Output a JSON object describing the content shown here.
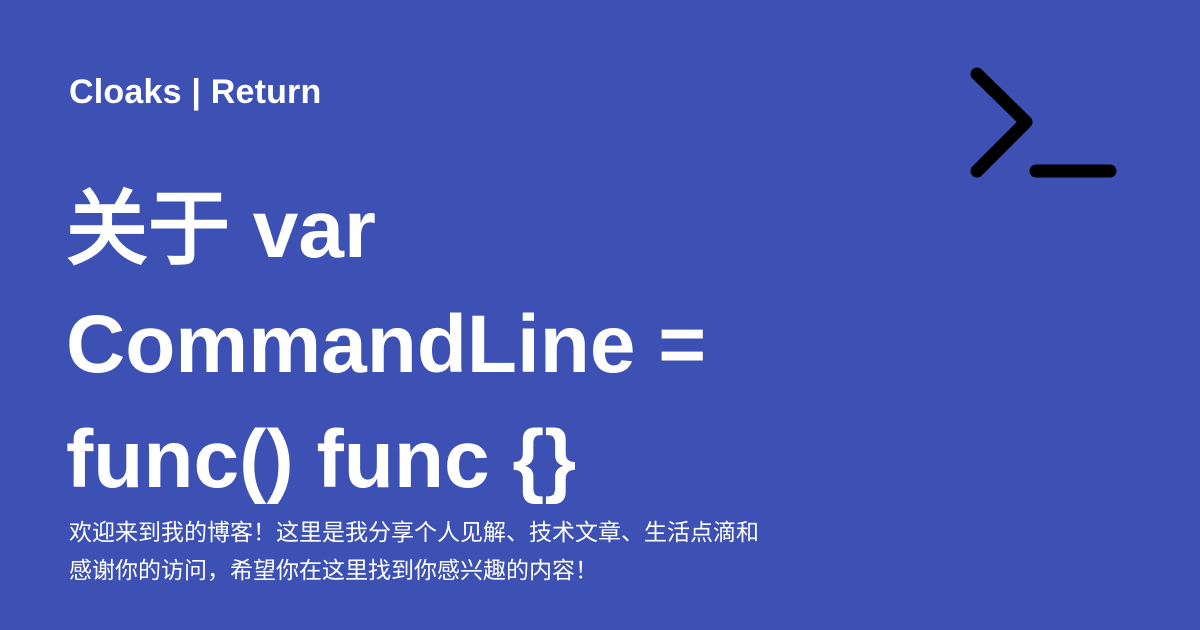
{
  "header": {
    "site_title": "Cloaks | Return"
  },
  "icon": {
    "name": "terminal-prompt-icon",
    "color": "#000000"
  },
  "post": {
    "title_lines": [
      "关于 var",
      "CommandLine =",
      "func() func {}"
    ],
    "description_lines": [
      "欢迎来到我的博客！这里是我分享个人见解、技术文章、生活点滴和",
      "感谢你的访问，希望你在这里找到你感兴趣的内容！"
    ]
  },
  "colors": {
    "background": "#3d51b4",
    "text": "#ffffff"
  }
}
